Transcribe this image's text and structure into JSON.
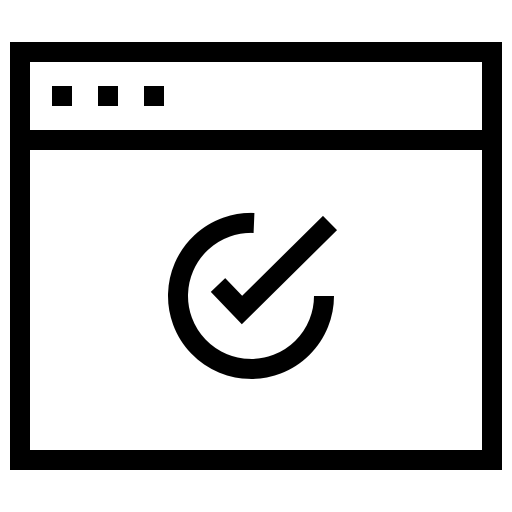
{
  "icon": {
    "name": "browser-window-check-icon",
    "window_buttons": [
      "dot-icon",
      "dot-icon",
      "dot-icon"
    ],
    "status_icon": "checkmark-circle-icon"
  },
  "colors": {
    "stroke": "#000000",
    "background": "#ffffff"
  }
}
